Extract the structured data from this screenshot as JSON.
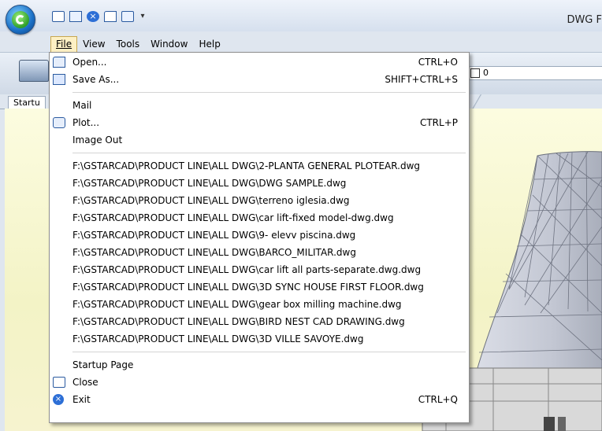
{
  "window": {
    "title": "DWG F"
  },
  "qat": {
    "more_glyph": "▾"
  },
  "menubar": [
    {
      "label": "File"
    },
    {
      "label": "View"
    },
    {
      "label": "Tools"
    },
    {
      "label": "Window"
    },
    {
      "label": "Help"
    }
  ],
  "layer_box": {
    "value": "0"
  },
  "tabs": {
    "startup": "Startu"
  },
  "file_menu": {
    "open": {
      "label": "Open...",
      "shortcut": "CTRL+O"
    },
    "save_as": {
      "label": "Save As...",
      "shortcut": "SHIFT+CTRL+S"
    },
    "mail": {
      "label": "Mail"
    },
    "plot": {
      "label": "Plot...",
      "shortcut": "CTRL+P"
    },
    "image_out": {
      "label": "Image Out"
    },
    "recent_files": [
      "F:\\GSTARCAD\\PRODUCT LINE\\ALL DWG\\2-PLANTA GENERAL PLOTEAR.dwg",
      "F:\\GSTARCAD\\PRODUCT LINE\\ALL DWG\\DWG SAMPLE.dwg",
      "F:\\GSTARCAD\\PRODUCT LINE\\ALL DWG\\terreno iglesia.dwg",
      "F:\\GSTARCAD\\PRODUCT LINE\\ALL DWG\\car lift-fixed model-dwg.dwg",
      "F:\\GSTARCAD\\PRODUCT LINE\\ALL DWG\\9- elevv piscina.dwg",
      "F:\\GSTARCAD\\PRODUCT LINE\\ALL DWG\\BARCO_MILITAR.dwg",
      "F:\\GSTARCAD\\PRODUCT LINE\\ALL DWG\\car lift all parts-separate.dwg.dwg",
      "F:\\GSTARCAD\\PRODUCT LINE\\ALL DWG\\3D SYNC HOUSE FIRST FLOOR.dwg",
      "F:\\GSTARCAD\\PRODUCT LINE\\ALL DWG\\gear box milling machine.dwg",
      "F:\\GSTARCAD\\PRODUCT LINE\\ALL DWG\\BIRD NEST CAD DRAWING.dwg",
      "F:\\GSTARCAD\\PRODUCT LINE\\ALL DWG\\3D VILLE SAVOYE.dwg"
    ],
    "startup_page": {
      "label": "Startup Page"
    },
    "close": {
      "label": "Close"
    },
    "exit": {
      "label": "Exit",
      "shortcut": "CTRL+Q"
    }
  },
  "icons": {
    "app": "gstarcad-logo-icon",
    "new": "new-file-icon",
    "new_window": "new-window-icon",
    "close": "close-icon",
    "open": "folder-open-icon",
    "plot": "printer-icon",
    "save_as": "save-as-icon",
    "exit": "exit-icon"
  }
}
